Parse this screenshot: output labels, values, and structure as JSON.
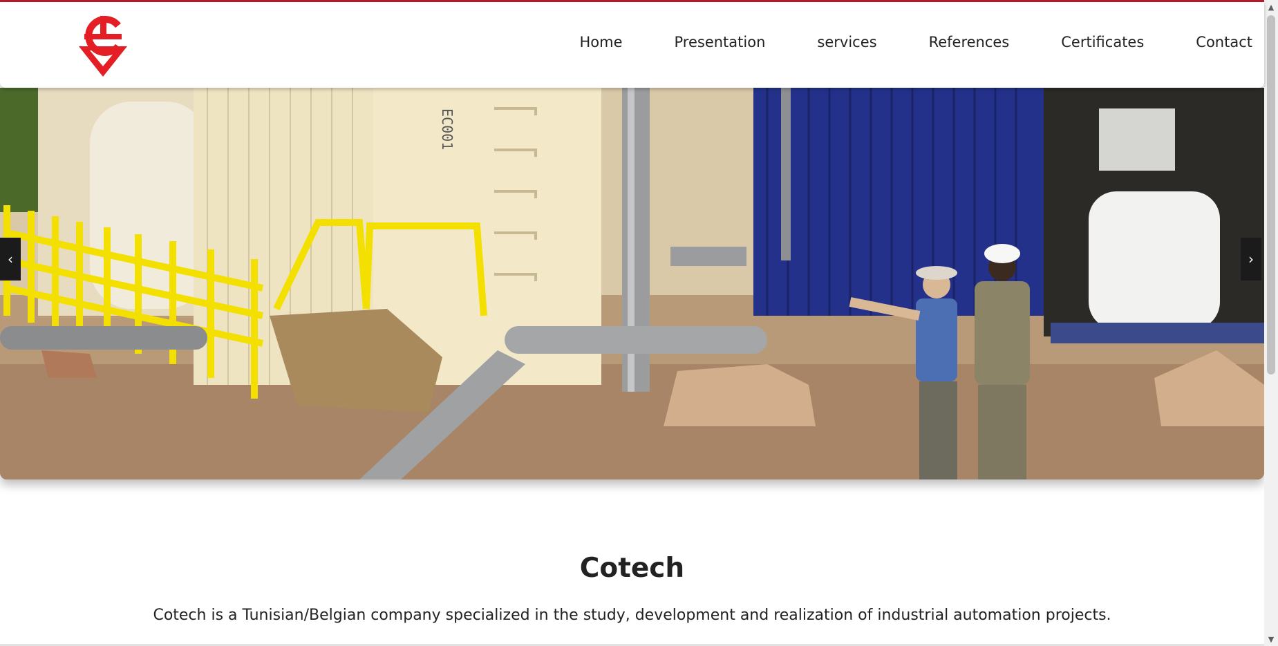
{
  "brand": {
    "name": "Cotech",
    "logo_icon": "cotech-logo-icon",
    "accent_color": "#e31e24",
    "topline_color": "#b71c2b"
  },
  "nav": {
    "items": [
      {
        "label": "Home"
      },
      {
        "label": "Presentation"
      },
      {
        "label": "services"
      },
      {
        "label": "References"
      },
      {
        "label": "Certificates"
      },
      {
        "label": "Contact"
      }
    ]
  },
  "carousel": {
    "prev_icon": "‹",
    "next_icon": "›",
    "image_alt": "Industrial water treatment site with containers, pipes and two workers"
  },
  "content": {
    "title": "Cotech",
    "description": "Cotech is a Tunisian/Belgian company specialized in the study, development and realization of industrial automation projects."
  }
}
